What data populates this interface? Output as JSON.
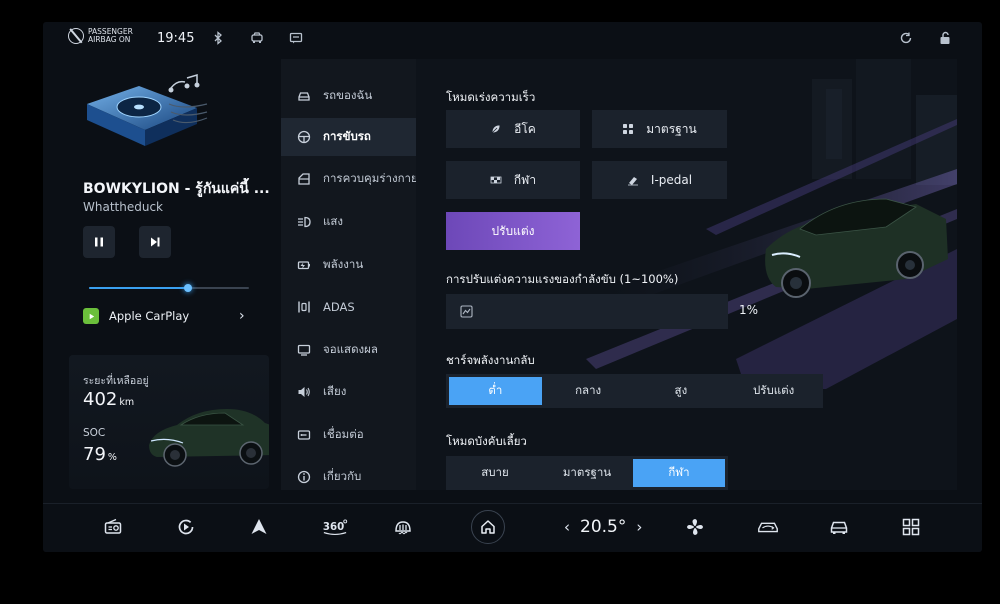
{
  "status_bar": {
    "airbag_line1": "PASSENGER",
    "airbag_line2": "AIRBAG ON",
    "time": "19:45"
  },
  "media": {
    "song_title": "BOWKYLION - รู้กันแค่นี้ ...",
    "artist": "Whattheduck",
    "progress": 0.62,
    "source_label": "Apple CarPlay"
  },
  "vehicle": {
    "range_label": "ระยะที่เหลืออยู่",
    "range_value": "402",
    "range_unit": "km",
    "soc_label": "SOC",
    "soc_value": "79",
    "soc_unit": "%"
  },
  "menu": {
    "items": [
      {
        "label": "รถของฉัน",
        "icon": "car-icon"
      },
      {
        "label": "การขับรถ",
        "icon": "steering-wheel-icon",
        "active": true
      },
      {
        "label": "การควบคุมร่างกาย",
        "icon": "car-door-icon"
      },
      {
        "label": "แสง",
        "icon": "headlight-icon"
      },
      {
        "label": "พลังงาน",
        "icon": "battery-icon"
      },
      {
        "label": "ADAS",
        "icon": "lane-assist-icon"
      },
      {
        "label": "จอแสดงผล",
        "icon": "display-icon"
      },
      {
        "label": "เสียง",
        "icon": "speaker-icon"
      },
      {
        "label": "เชื่อมต่อ",
        "icon": "connect-icon"
      },
      {
        "label": "เกี่ยวกับ",
        "icon": "info-icon"
      }
    ]
  },
  "driving": {
    "accel_title": "โหมดเร่งความเร็ว",
    "modes": [
      {
        "label": "อีโค",
        "icon": "leaf-icon"
      },
      {
        "label": "มาตรฐาน",
        "icon": "grid-icon"
      },
      {
        "label": "กีฬา",
        "icon": "sport-flag-icon"
      },
      {
        "label": "I-pedal",
        "icon": "pedal-icon"
      },
      {
        "label": "ปรับแต่ง",
        "icon": ""
      }
    ],
    "power_title": "การปรับแต่งความแรงของกำลังขับ (1~100%)",
    "power_value": "1%",
    "regen_title": "ชาร์จพลังงานกลับ",
    "regen_options": [
      "ต่ำ",
      "กลาง",
      "สูง",
      "ปรับแต่ง"
    ],
    "regen_selected": 0,
    "steer_title": "โหมดบังคับเลี้ยว",
    "steer_options": [
      "สบาย",
      "มาตรฐาน",
      "กีฬา"
    ],
    "steer_selected": 2
  },
  "dock": {
    "temperature": "20.5°"
  },
  "colors": {
    "accent_blue": "#4aa3f5",
    "custom_purple": "#7d55c7",
    "carplay_green": "#6bbf3b"
  }
}
